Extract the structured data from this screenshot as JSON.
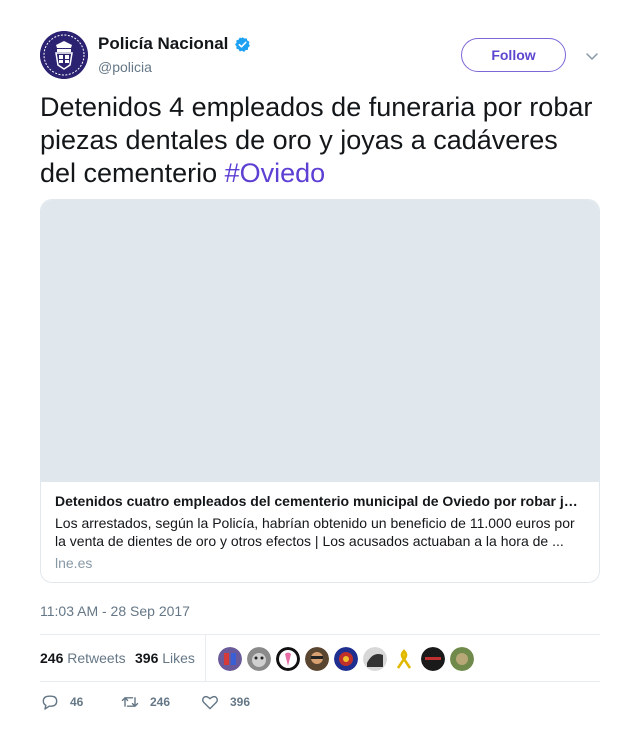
{
  "header": {
    "display_name": "Policía Nacional",
    "handle": "@policia",
    "follow_label": "Follow",
    "verified_icon": "verified-badge-icon",
    "avatar_icon": "police-crest-avatar"
  },
  "tweet": {
    "text": "Detenidos 4 empleados de funeraria por robar piezas dentales de oro y joyas a cadáveres del cementerio ",
    "hashtag": "#Oviedo"
  },
  "card": {
    "title": "Detenidos cuatro empleados del cementerio municipal de Oviedo por robar j…",
    "description": "Los arrestados, según la Policía, habrían obtenido un beneficio de 11.000 euros por la venta de dientes de oro y otros efectos | Los acusados actuaban a la hora de ...",
    "domain": "lne.es"
  },
  "timestamp": "11:03 AM - 28 Sep 2017",
  "stats": {
    "retweets_count": "246",
    "retweets_label": "Retweets",
    "likes_count": "396",
    "likes_label": "Likes"
  },
  "actions": {
    "reply_count": "46",
    "retweet_count": "246",
    "like_count": "396"
  },
  "colors": {
    "accent": "#5c47cf",
    "hashtag": "#5d3fd3",
    "verified": "#1da1f2",
    "muted": "#657786"
  }
}
